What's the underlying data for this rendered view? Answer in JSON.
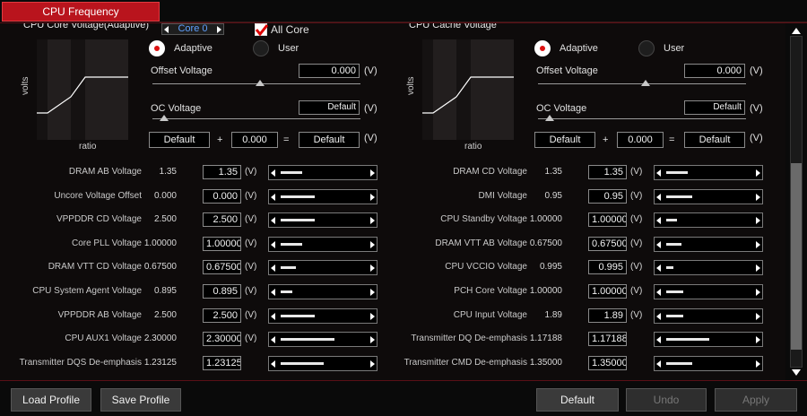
{
  "tab": {
    "label": "CPU Frequency"
  },
  "core": {
    "label": "Core 0",
    "all_core_label": "All Core",
    "all_core_checked": true
  },
  "left_panel": {
    "title": "CPU Core Voltage(Adaptive)",
    "ylabel": "volts",
    "xlabel": "ratio",
    "adaptive_label": "Adaptive",
    "user_label": "User",
    "adaptive_selected": true,
    "offset_label": "Offset Voltage",
    "offset_value": "0.000",
    "offset_unit": "(V)",
    "oc_label": "OC Voltage",
    "oc_value": "Default",
    "oc_unit": "(V)",
    "sum_a": "Default",
    "plus": "+",
    "sum_b": "0.000",
    "equals": "=",
    "sum_c": "Default",
    "sum_unit": "(V)"
  },
  "right_panel": {
    "title": "CPU Cache Voltage",
    "ylabel": "volts",
    "xlabel": "ratio",
    "adaptive_label": "Adaptive",
    "user_label": "User",
    "adaptive_selected": true,
    "offset_label": "Offset Voltage",
    "offset_value": "0.000",
    "offset_unit": "(V)",
    "oc_label": "OC Voltage",
    "oc_value": "Default",
    "oc_unit": "(V)",
    "sum_a": "Default",
    "plus": "+",
    "sum_b": "0.000",
    "equals": "=",
    "sum_c": "Default",
    "sum_unit": "(V)"
  },
  "left_rows": [
    {
      "label": "DRAM AB Voltage",
      "default": "1.35",
      "value": "1.35",
      "unit": "(V)",
      "level": 0.25
    },
    {
      "label": "Uncore Voltage Offset",
      "default": "0.000",
      "value": "0.000",
      "unit": "(V)",
      "level": 0.4
    },
    {
      "label": "VPPDDR CD Voltage",
      "default": "2.500",
      "value": "2.500",
      "unit": "(V)",
      "level": 0.4
    },
    {
      "label": "Core PLL Voltage",
      "default": "1.00000",
      "value": "1.00000",
      "unit": "(V)",
      "level": 0.25
    },
    {
      "label": "DRAM VTT CD Voltage",
      "default": "0.67500",
      "value": "0.67500",
      "unit": "(V)",
      "level": 0.18
    },
    {
      "label": "CPU System Agent Voltage",
      "default": "0.895",
      "value": "0.895",
      "unit": "(V)",
      "level": 0.14
    },
    {
      "label": "VPPDDR AB Voltage",
      "default": "2.500",
      "value": "2.500",
      "unit": "(V)",
      "level": 0.4
    },
    {
      "label": "CPU AUX1 Voltage",
      "default": "2.30000",
      "value": "2.30000",
      "unit": "(V)",
      "level": 0.62
    },
    {
      "label": "Transmitter DQS De-emphasis",
      "default": "1.23125",
      "value": "1.23125",
      "unit": "",
      "level": 0.5
    }
  ],
  "right_rows": [
    {
      "label": "DRAM CD Voltage",
      "default": "1.35",
      "value": "1.35",
      "unit": "(V)",
      "level": 0.25
    },
    {
      "label": "DMI Voltage",
      "default": "0.95",
      "value": "0.95",
      "unit": "(V)",
      "level": 0.3
    },
    {
      "label": "CPU Standby Voltage",
      "default": "1.00000",
      "value": "1.00000",
      "unit": "(V)",
      "level": 0.12
    },
    {
      "label": "DRAM VTT AB Voltage",
      "default": "0.67500",
      "value": "0.67500",
      "unit": "(V)",
      "level": 0.18
    },
    {
      "label": "CPU VCCIO Voltage",
      "default": "0.995",
      "value": "0.995",
      "unit": "(V)",
      "level": 0.08
    },
    {
      "label": "PCH Core Voltage",
      "default": "1.00000",
      "value": "1.00000",
      "unit": "(V)",
      "level": 0.2
    },
    {
      "label": "CPU Input Voltage",
      "default": "1.89",
      "value": "1.89",
      "unit": "(V)",
      "level": 0.2
    },
    {
      "label": "Transmitter DQ De-emphasis",
      "default": "1.17188",
      "value": "1.17188",
      "unit": "",
      "level": 0.5
    },
    {
      "label": "Transmitter CMD De-emphasis",
      "default": "1.35000",
      "value": "1.35000",
      "unit": "",
      "level": 0.3
    }
  ],
  "buttons": {
    "load_profile": "Load Profile",
    "save_profile": "Save Profile",
    "default": "Default",
    "undo": "Undo",
    "apply": "Apply"
  },
  "colors": {
    "accent": "#b9141d",
    "core_text": "#5fa0ff"
  }
}
